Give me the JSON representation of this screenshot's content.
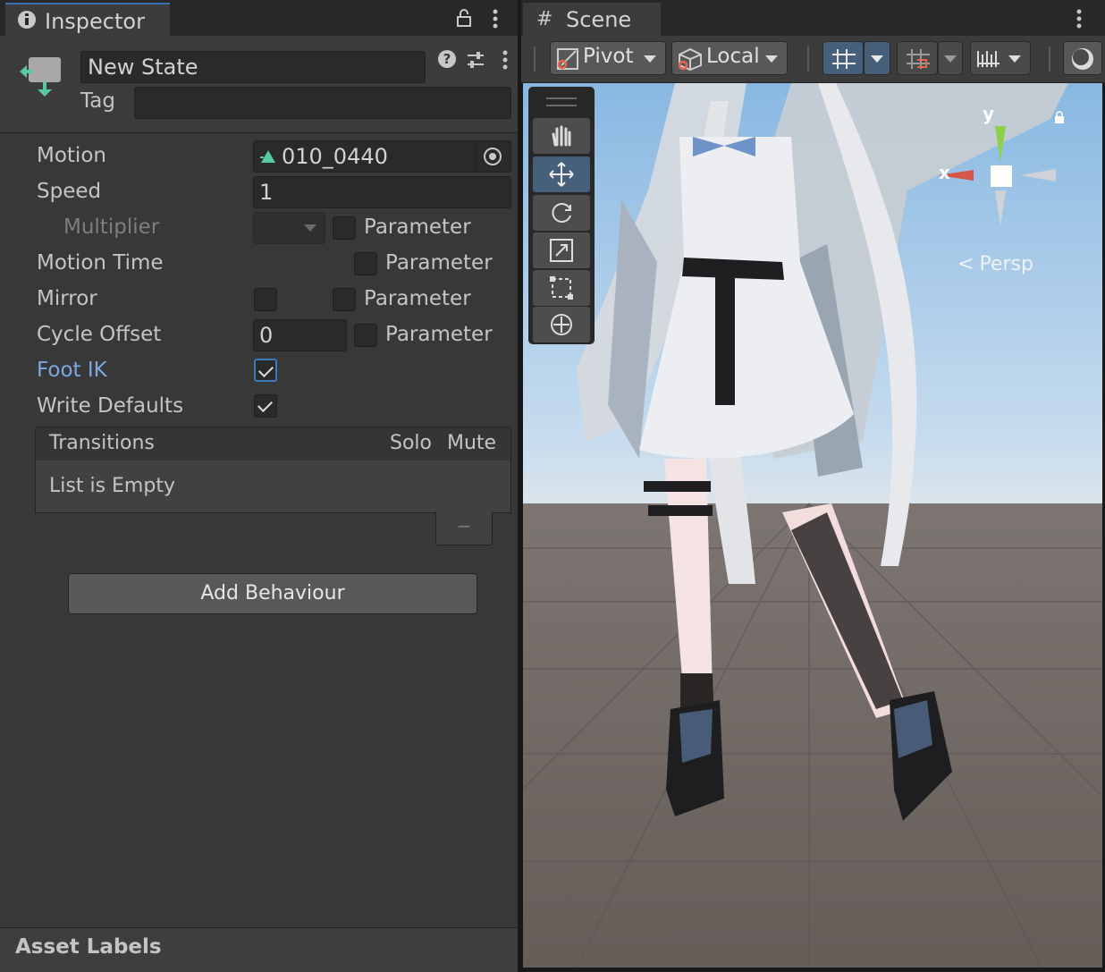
{
  "inspector": {
    "tab_label": "Inspector",
    "name_value": "New State",
    "tag_label": "Tag",
    "tag_value": "",
    "properties": {
      "motion_label": "Motion",
      "motion_value": "010_0440",
      "speed_label": "Speed",
      "speed_value": "1",
      "multiplier_label": "Multiplier",
      "parameter_label": "Parameter",
      "motion_time_label": "Motion Time",
      "mirror_label": "Mirror",
      "cycle_offset_label": "Cycle Offset",
      "cycle_offset_value": "0",
      "foot_ik_label": "Foot IK",
      "write_defaults_label": "Write Defaults"
    },
    "checkbox_state": {
      "multiplier_parameter": false,
      "motion_time_parameter": false,
      "mirror": false,
      "mirror_parameter": false,
      "cycle_offset_parameter": false,
      "foot_ik": true,
      "write_defaults": true
    },
    "transitions": {
      "header": "Transitions",
      "solo": "Solo",
      "mute": "Mute",
      "empty_text": "List is Empty",
      "remove_button": "−"
    },
    "add_behaviour_label": "Add Behaviour",
    "asset_labels": "Asset Labels",
    "icons": [
      "info-icon",
      "lock-icon",
      "kebab-menu-icon",
      "state-icon",
      "help-icon",
      "preset-icon",
      "animation-clip-icon",
      "object-picker-icon",
      "dropdown-arrow-icon"
    ]
  },
  "scene": {
    "tab_label": "Scene",
    "pivot_label": "Pivot",
    "local_label": "Local",
    "persp_label": "Persp",
    "gizmo_y": "y",
    "gizmo_x": "x",
    "tools": [
      "hand-tool",
      "move-tool",
      "rotate-tool",
      "scale-tool",
      "rect-tool",
      "transform-tool"
    ],
    "active_tool": "move-tool"
  },
  "colors": {
    "accent_blue": "#3a79bb",
    "foot_ik_label": "#7ea7e0",
    "panel_bg": "#383838",
    "sky": "#a9cbe9",
    "ground": "#6a625d"
  }
}
